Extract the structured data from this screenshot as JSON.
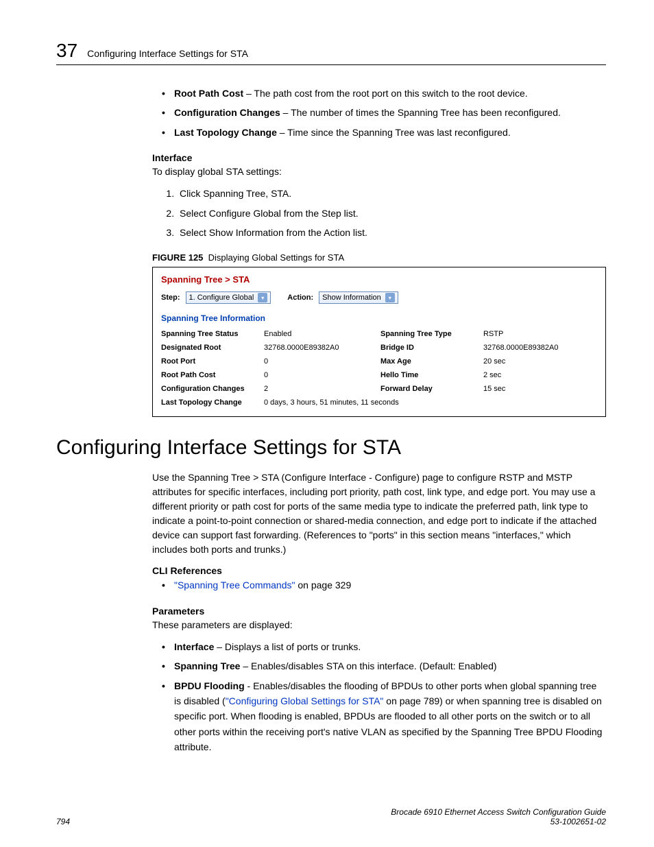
{
  "header": {
    "chapter_number": "37",
    "chapter_title": "Configuring Interface Settings for STA"
  },
  "top_bullets": [
    {
      "term": "Root Path Cost",
      "desc": " – The path cost from the root port on this switch to the root device."
    },
    {
      "term": "Configuration Changes",
      "desc": " – The number of times the Spanning Tree has been reconfigured."
    },
    {
      "term": "Last Topology Change",
      "desc": " – Time since the Spanning Tree was last reconfigured."
    }
  ],
  "interface_head": "Interface",
  "interface_intro": "To display global STA settings:",
  "interface_steps": [
    "Click Spanning Tree, STA.",
    "Select Configure Global from the Step list.",
    "Select Show Information from the Action list."
  ],
  "figure": {
    "label": "FIGURE 125",
    "caption": "Displaying Global Settings for STA",
    "breadcrumb": "Spanning Tree > STA",
    "step_label": "Step:",
    "step_value": "1. Configure Global",
    "action_label": "Action:",
    "action_value": "Show Information",
    "section_title": "Spanning Tree Information",
    "rows": [
      {
        "l1": "Spanning Tree Status",
        "v1": "Enabled",
        "l2": "Spanning Tree Type",
        "v2": "RSTP"
      },
      {
        "l1": "Designated Root",
        "v1": "32768.0000E89382A0",
        "l2": "Bridge ID",
        "v2": "32768.0000E89382A0"
      },
      {
        "l1": "Root Port",
        "v1": "0",
        "l2": "Max Age",
        "v2": "20 sec"
      },
      {
        "l1": "Root Path Cost",
        "v1": "0",
        "l2": "Hello Time",
        "v2": "2 sec"
      },
      {
        "l1": "Configuration Changes",
        "v1": "2",
        "l2": "Forward Delay",
        "v2": "15 sec"
      }
    ],
    "last_row": {
      "l1": "Last Topology Change",
      "v1": "0 days, 3 hours, 51 minutes, 11 seconds"
    }
  },
  "h1": "Configuring Interface Settings for STA",
  "main_para": "Use the Spanning Tree > STA (Configure Interface - Configure) page to configure RSTP and MSTP attributes for specific interfaces, including port priority, path cost, link type, and edge port. You may use a different priority or path cost for ports of the same media type to indicate the preferred path, link type to indicate a point-to-point connection or shared-media connection, and edge port to indicate if the attached device can support fast forwarding. (References to \"ports\" in this section means \"interfaces,\" which includes both ports and trunks.)",
  "cli_head": "CLI References",
  "cli_link": "\"Spanning Tree Commands\"",
  "cli_rest": " on page 329",
  "params_head": "Parameters",
  "params_intro": "These parameters are displayed:",
  "params": {
    "p1_term": "Interface",
    "p1_desc": " – Displays a list of ports or trunks.",
    "p2_term": "Spanning Tree",
    "p2_desc": " – Enables/disables STA on this interface. (Default: Enabled)",
    "p3_term": "BPDU Flooding",
    "p3_a": " - Enables/disables the flooding of BPDUs to other ports when global spanning tree is disabled (",
    "p3_link": "\"Configuring Global Settings for STA\"",
    "p3_b": " on page 789) or when spanning tree is disabled on specific port. When flooding is enabled, BPDUs are flooded to all other ports on the switch or to all other ports within the receiving port's native VLAN as specified by the Spanning Tree BPDU Flooding attribute."
  },
  "footer": {
    "page": "794",
    "book": "Brocade 6910 Ethernet Access Switch Configuration Guide",
    "docnum": "53-1002651-02"
  }
}
